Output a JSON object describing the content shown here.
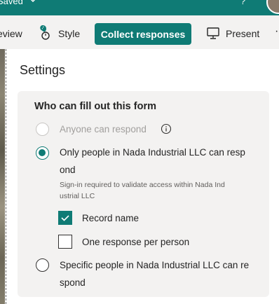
{
  "header": {
    "saved_status": "Saved",
    "help_glyph": "?",
    "icons": [
      "chevron-down-icon",
      "help-icon",
      "avatar"
    ]
  },
  "toolbar": {
    "preview_label": "eview",
    "style_label": "Style",
    "collect_label": "Collect responses",
    "present_label": "Present",
    "more_glyph": "·",
    "icons": [
      "style-palette-icon",
      "present-monitor-icon",
      "more-icon"
    ]
  },
  "settings": {
    "title": "Settings",
    "section_title": "Who can fill out this form",
    "options": [
      {
        "label": "Anyone can respond",
        "state": "disabled"
      },
      {
        "label_line1": "Only people in Nada Industrial LLC can resp",
        "label_line2": "ond",
        "state": "selected",
        "subtext_line1": "Sign-in required to validate access within Nada Ind",
        "subtext_line2": "ustrial LLC"
      },
      {
        "label_line1": "Specific people in Nada Industrial LLC can re",
        "label_line2": "spond",
        "state": "unselected"
      }
    ],
    "checkboxes": [
      {
        "label": "Record name",
        "checked": true
      },
      {
        "label": "One response per person",
        "checked": false
      }
    ]
  },
  "colors": {
    "brand": "#0f7b75",
    "panel_bg": "#f3f2f1",
    "text": "#242424",
    "disabled_text": "#a19f9d"
  }
}
